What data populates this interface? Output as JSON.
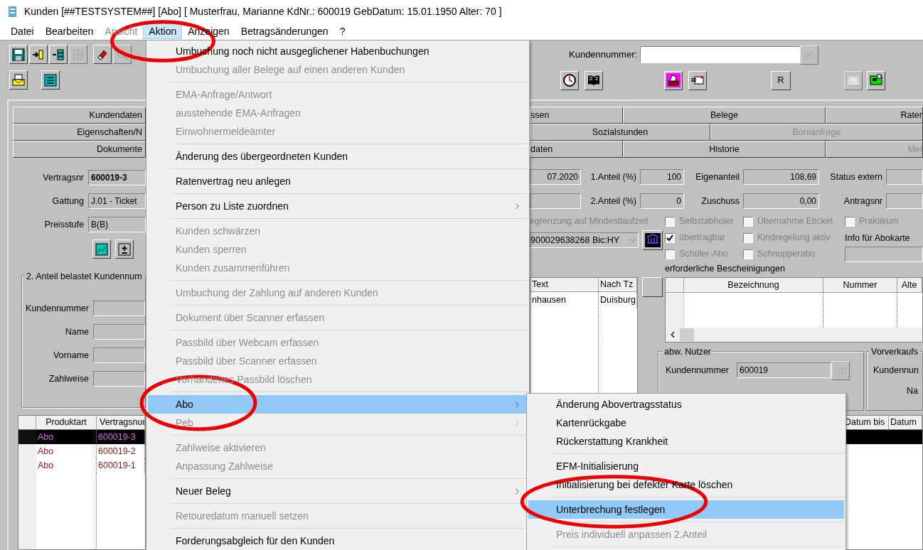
{
  "window": {
    "title": "Kunden [##TESTSYSTEM##] [Abo] [ Musterfrau, Marianne KdNr.: 600019 GebDatum: 15.01.1950 Alter: 70 ]"
  },
  "menubar": [
    {
      "label": "Datei",
      "selected": false,
      "disabled": false,
      "circled": false
    },
    {
      "label": "Bearbeiten",
      "selected": false,
      "disabled": false,
      "circled": false
    },
    {
      "label": "Ansicht",
      "selected": false,
      "disabled": true,
      "circled": false
    },
    {
      "label": "Aktion",
      "selected": true,
      "disabled": false,
      "circled": true
    },
    {
      "label": "Anzeigen",
      "selected": false,
      "disabled": false,
      "circled": false
    },
    {
      "label": "Betragsänderungen",
      "selected": false,
      "disabled": false,
      "circled": false
    },
    {
      "label": "?",
      "selected": false,
      "disabled": false,
      "circled": false
    }
  ],
  "customer_search": {
    "label": "Kundennummer:"
  },
  "r_button": {
    "label": "R"
  },
  "tabs": {
    "left_rows": [
      {
        "label": "Kundendaten"
      },
      {
        "label": "Eigenschaften/N"
      },
      {
        "label": "Dokumente"
      }
    ],
    "right_rows": [
      {
        "cells": [
          {
            "label": "ssen",
            "disabled": false
          },
          {
            "label": "Belege",
            "disabled": false
          },
          {
            "label": "Rater",
            "disabled": false
          }
        ]
      },
      {
        "cells": [
          {
            "label": "Sozialstunden",
            "disabled": false
          },
          {
            "label": "Bonianfrage",
            "disabled": true
          }
        ]
      },
      {
        "cells": [
          {
            "label": "daten",
            "disabled": false
          },
          {
            "label": "Historie",
            "disabled": false
          },
          {
            "label": "Mel",
            "disabled": true
          }
        ]
      }
    ]
  },
  "contract_fields": [
    {
      "label": "Vertragsnr",
      "value": "600019-3",
      "bold": true
    },
    {
      "label": "Gattung",
      "value": "J.01 - Ticket",
      "bold": false
    },
    {
      "label": "Preisstufe",
      "value": "B(B)",
      "bold": false
    }
  ],
  "second_share": {
    "legend": "2. Anteil belastet Kundennum",
    "fields": [
      "Kundennummer",
      "Name",
      "Vorname",
      "Zahlweise"
    ]
  },
  "products_table": {
    "columns": [
      "Produktart",
      "Vertragsnur"
    ],
    "rows": [
      {
        "cells": [
          "Abo",
          "600019-3"
        ],
        "selected": true
      },
      {
        "cells": [
          "Abo",
          "600019-2"
        ],
        "selected": false
      },
      {
        "cells": [
          "Abo",
          "600019-1"
        ],
        "selected": false
      }
    ]
  },
  "amount_rows": [
    {
      "items": [
        {
          "kind": "field",
          "value": "07.2020"
        },
        {
          "kind": "label",
          "text": "1.Anteil (%)"
        },
        {
          "kind": "field",
          "value": "100"
        },
        {
          "kind": "label",
          "text": "Eigenanteil"
        },
        {
          "kind": "field",
          "value": "108,69"
        },
        {
          "kind": "label",
          "text": "Status extern"
        },
        {
          "kind": "field"
        }
      ]
    },
    {
      "items": [
        {
          "kind": "field"
        },
        {
          "kind": "label",
          "text": "2.Anteil (%)"
        },
        {
          "kind": "field",
          "value": "0"
        },
        {
          "kind": "label",
          "text": "Zuschuss"
        },
        {
          "kind": "field",
          "value": "0,00"
        },
        {
          "kind": "label",
          "text": "Antragsnr"
        },
        {
          "kind": "field"
        }
      ]
    }
  ],
  "term_limit": {
    "label": "egrenzung auf Mindestlaufzeit",
    "disabled": true
  },
  "bank_dropdown": {
    "value": "900029638268 Bic:HY"
  },
  "checkboxes": [
    {
      "label": "Selbstabholer",
      "checked": false,
      "disabled": true
    },
    {
      "label": "Übernahme Eticket",
      "checked": false,
      "disabled": true
    },
    {
      "label": "übertragbar",
      "checked": true,
      "disabled": true
    },
    {
      "label": "Kindregelung aktiv",
      "checked": false,
      "disabled": true
    },
    {
      "label": "Schüler-Abo",
      "checked": false,
      "disabled": true
    },
    {
      "label": "Schnupperabo",
      "checked": false,
      "disabled": true
    }
  ],
  "info_column": {
    "checkbox": {
      "label": "Praktikum",
      "checked": false,
      "disabled": true
    },
    "label": "Info für Abokarte"
  },
  "certificates": {
    "title": "erforderliche Bescheinigungen",
    "columns": [
      "Bezeichnung",
      "Nummer",
      "Alte"
    ]
  },
  "route_table": {
    "columns": [
      "Text",
      "Nach Tz"
    ],
    "rows": [
      {
        "cells": [
          "nhausen",
          "Duisburg"
        ]
      }
    ]
  },
  "alt_user": {
    "legend": "abw. Nutzer",
    "label": "Kundennummer",
    "value": "600019"
  },
  "presale": {
    "legend": "Vorverkaufs",
    "label": "Kundennun",
    "label_2": "Na"
  },
  "right_table": {
    "columns": [
      "Datum bis",
      "Datum"
    ],
    "rows": [
      {
        "selected": true
      }
    ]
  },
  "action_menu": {
    "items": [
      {
        "kind": "item",
        "label": "Umbuchung noch nicht ausgeglichener Habenbuchungen",
        "disabled": false,
        "selected": false,
        "submenu": false,
        "circled": false
      },
      {
        "kind": "item",
        "label": "Umbuchung aller Belege auf einen anderen Kunden",
        "disabled": true,
        "selected": false,
        "submenu": false,
        "circled": false
      },
      {
        "kind": "separator"
      },
      {
        "kind": "item",
        "label": "EMA-Anfrage/Antwort",
        "disabled": true,
        "selected": false,
        "submenu": false,
        "circled": false
      },
      {
        "kind": "item",
        "label": "ausstehende EMA-Anfragen",
        "disabled": true,
        "selected": false,
        "submenu": false,
        "circled": false
      },
      {
        "kind": "item",
        "label": "Einwohnermeldeämter",
        "disabled": true,
        "selected": false,
        "submenu": false,
        "circled": false
      },
      {
        "kind": "separator"
      },
      {
        "kind": "item",
        "label": "Änderung des übergeordneten Kunden",
        "disabled": false,
        "selected": false,
        "submenu": false,
        "circled": false
      },
      {
        "kind": "separator"
      },
      {
        "kind": "item",
        "label": "Ratenvertrag neu anlegen",
        "disabled": false,
        "selected": false,
        "submenu": false,
        "circled": false
      },
      {
        "kind": "separator"
      },
      {
        "kind": "item",
        "label": "Person zu Liste zuordnen",
        "disabled": false,
        "selected": false,
        "submenu": true,
        "circled": false
      },
      {
        "kind": "separator"
      },
      {
        "kind": "item",
        "label": "Kunden schwärzen",
        "disabled": true,
        "selected": false,
        "submenu": false,
        "circled": false
      },
      {
        "kind": "item",
        "label": "Kunden sperren",
        "disabled": true,
        "selected": false,
        "submenu": false,
        "circled": false
      },
      {
        "kind": "item",
        "label": "Kunden zusammenführen",
        "disabled": true,
        "selected": false,
        "submenu": false,
        "circled": false
      },
      {
        "kind": "separator"
      },
      {
        "kind": "item",
        "label": "Umbuchung der Zahlung auf anderen Kunden",
        "disabled": true,
        "selected": false,
        "submenu": false,
        "circled": false
      },
      {
        "kind": "separator"
      },
      {
        "kind": "item",
        "label": "Dokument über Scanner erfassen",
        "disabled": true,
        "selected": false,
        "submenu": false,
        "circled": false
      },
      {
        "kind": "separator"
      },
      {
        "kind": "item",
        "label": "Passbild über Webcam erfassen",
        "disabled": true,
        "selected": false,
        "submenu": false,
        "circled": false
      },
      {
        "kind": "item",
        "label": "Passbild über Scanner erfassen",
        "disabled": true,
        "selected": false,
        "submenu": false,
        "circled": false
      },
      {
        "kind": "item",
        "label": "Vorhandenes Passbild löschen",
        "disabled": true,
        "selected": false,
        "submenu": false,
        "circled": false
      },
      {
        "kind": "separator"
      },
      {
        "kind": "item",
        "label": "Abo",
        "disabled": false,
        "selected": true,
        "submenu": true,
        "circled": true
      },
      {
        "kind": "item",
        "label": "Peb",
        "disabled": true,
        "selected": false,
        "submenu": true,
        "circled": false
      },
      {
        "kind": "separator"
      },
      {
        "kind": "item",
        "label": "Zahlweise aktivieren",
        "disabled": true,
        "selected": false,
        "submenu": false,
        "circled": false
      },
      {
        "kind": "item",
        "label": "Anpassung Zahlweise",
        "disabled": true,
        "selected": false,
        "submenu": false,
        "circled": false
      },
      {
        "kind": "separator"
      },
      {
        "kind": "item",
        "label": "Neuer Beleg",
        "disabled": false,
        "selected": false,
        "submenu": true,
        "circled": false
      },
      {
        "kind": "separator"
      },
      {
        "kind": "item",
        "label": "Retouredatum manuell setzen",
        "disabled": true,
        "selected": false,
        "submenu": false,
        "circled": false
      },
      {
        "kind": "separator"
      },
      {
        "kind": "item",
        "label": "Forderungsabgleich für den Kunden",
        "disabled": false,
        "selected": false,
        "submenu": false,
        "circled": false
      }
    ]
  },
  "abo_submenu": {
    "items": [
      {
        "kind": "item",
        "label": "Änderung Abovertragsstatus",
        "disabled": false,
        "selected": false,
        "submenu": false,
        "circled": false
      },
      {
        "kind": "item",
        "label": "Kartenrückgabe",
        "disabled": false,
        "selected": false,
        "submenu": false,
        "circled": false
      },
      {
        "kind": "item",
        "label": "Rückerstattung Krankheit",
        "disabled": false,
        "selected": false,
        "submenu": false,
        "circled": false
      },
      {
        "kind": "separator"
      },
      {
        "kind": "item",
        "label": "EFM-Initialisierung",
        "disabled": false,
        "selected": false,
        "submenu": false,
        "circled": false
      },
      {
        "kind": "item",
        "label": "Initialisierung bei defekter Karte löschen",
        "disabled": false,
        "selected": false,
        "submenu": false,
        "circled": false
      },
      {
        "kind": "separator"
      },
      {
        "kind": "item",
        "label": "Unterbrechung festlegen",
        "disabled": false,
        "selected": true,
        "submenu": false,
        "circled": true
      },
      {
        "kind": "separator"
      },
      {
        "kind": "item",
        "label": "Preis individuell anpassen 2.Anteil",
        "disabled": true,
        "selected": false,
        "submenu": false,
        "circled": false
      },
      {
        "kind": "separator"
      }
    ]
  }
}
